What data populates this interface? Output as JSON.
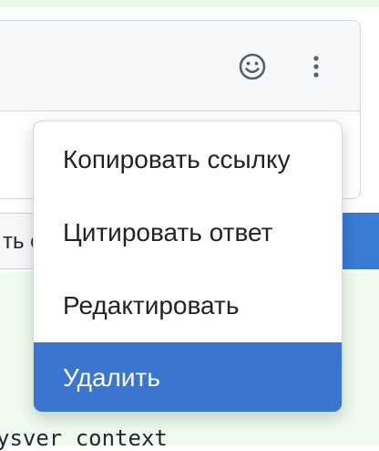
{
  "comment": {
    "left_button_label": "ть с",
    "code_text": "ysver context"
  },
  "menu": {
    "items": [
      {
        "id": "copy-link",
        "label": "Копировать ссылку",
        "selected": false
      },
      {
        "id": "quote-reply",
        "label": "Цитировать ответ",
        "selected": false
      },
      {
        "id": "edit",
        "label": "Редактировать",
        "selected": false
      },
      {
        "id": "delete",
        "label": "Удалить",
        "selected": true
      }
    ]
  },
  "colors": {
    "accent": "#3a76cf",
    "header_bg": "#f6f8fa",
    "success_bg": "#eefbee"
  },
  "icons": {
    "reaction": "smiley-icon",
    "more": "kebab-horizontal-icon"
  }
}
